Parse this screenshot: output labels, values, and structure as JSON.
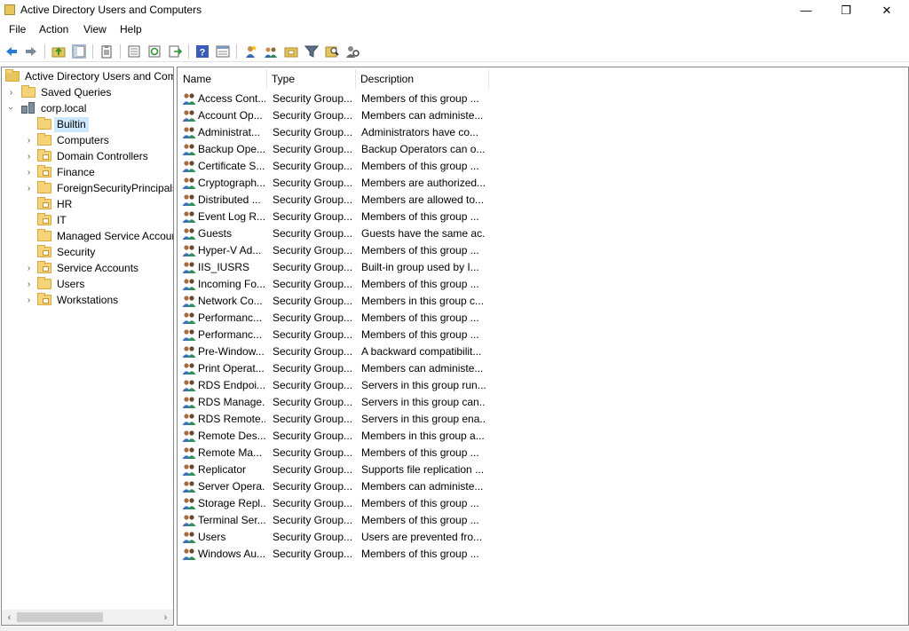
{
  "window": {
    "title": "Active Directory Users and Computers",
    "minimize_glyph": "—",
    "restore_glyph": "❐",
    "close_glyph": "✕"
  },
  "menu": [
    "File",
    "Action",
    "View",
    "Help"
  ],
  "toolbar_icons": [
    "back-icon",
    "forward-icon",
    "up-folder-icon",
    "show-console-tree-icon",
    "properties-icon",
    "export-list-icon",
    "refresh-icon",
    "export-icon",
    "help-icon",
    "details-icon",
    "new-user-icon",
    "new-group-icon",
    "new-ou-icon",
    "filter-icon",
    "find-icon",
    "delegate-icon"
  ],
  "tree": {
    "root": "Active Directory Users and Com",
    "saved_queries": "Saved Queries",
    "domain": "corp.local",
    "items": [
      {
        "label": "Builtin",
        "selected": true,
        "expandable": false,
        "ou": false
      },
      {
        "label": "Computers",
        "selected": false,
        "expandable": true,
        "ou": false
      },
      {
        "label": "Domain Controllers",
        "selected": false,
        "expandable": true,
        "ou": true
      },
      {
        "label": "Finance",
        "selected": false,
        "expandable": true,
        "ou": true
      },
      {
        "label": "ForeignSecurityPrincipals",
        "selected": false,
        "expandable": true,
        "ou": false
      },
      {
        "label": "HR",
        "selected": false,
        "expandable": false,
        "ou": true
      },
      {
        "label": "IT",
        "selected": false,
        "expandable": false,
        "ou": true
      },
      {
        "label": "Managed Service Accounts",
        "selected": false,
        "expandable": false,
        "ou": false
      },
      {
        "label": "Security",
        "selected": false,
        "expandable": false,
        "ou": true
      },
      {
        "label": "Service Accounts",
        "selected": false,
        "expandable": true,
        "ou": true
      },
      {
        "label": "Users",
        "selected": false,
        "expandable": true,
        "ou": false
      },
      {
        "label": "Workstations",
        "selected": false,
        "expandable": true,
        "ou": true
      }
    ]
  },
  "list": {
    "columns": [
      "Name",
      "Type",
      "Description"
    ],
    "rows": [
      {
        "name": "Access Cont...",
        "type": "Security Group...",
        "description": "Members of this group ..."
      },
      {
        "name": "Account Op...",
        "type": "Security Group...",
        "description": "Members can administe..."
      },
      {
        "name": "Administrat...",
        "type": "Security Group...",
        "description": "Administrators have co..."
      },
      {
        "name": "Backup Ope...",
        "type": "Security Group...",
        "description": "Backup Operators can o..."
      },
      {
        "name": "Certificate S...",
        "type": "Security Group...",
        "description": "Members of this group ..."
      },
      {
        "name": "Cryptograph...",
        "type": "Security Group...",
        "description": "Members are authorized..."
      },
      {
        "name": "Distributed ...",
        "type": "Security Group...",
        "description": "Members are allowed to..."
      },
      {
        "name": "Event Log R...",
        "type": "Security Group...",
        "description": "Members of this group ..."
      },
      {
        "name": "Guests",
        "type": "Security Group...",
        "description": "Guests have the same ac..."
      },
      {
        "name": "Hyper-V Ad...",
        "type": "Security Group...",
        "description": "Members of this group ..."
      },
      {
        "name": "IIS_IUSRS",
        "type": "Security Group...",
        "description": "Built-in group used by I..."
      },
      {
        "name": "Incoming Fo...",
        "type": "Security Group...",
        "description": "Members of this group ..."
      },
      {
        "name": "Network Co...",
        "type": "Security Group...",
        "description": "Members in this group c..."
      },
      {
        "name": "Performanc...",
        "type": "Security Group...",
        "description": "Members of this group ..."
      },
      {
        "name": "Performanc...",
        "type": "Security Group...",
        "description": "Members of this group ..."
      },
      {
        "name": "Pre-Window...",
        "type": "Security Group...",
        "description": "A backward compatibilit..."
      },
      {
        "name": "Print Operat...",
        "type": "Security Group...",
        "description": "Members can administe..."
      },
      {
        "name": "RDS Endpoi...",
        "type": "Security Group...",
        "description": "Servers in this group run..."
      },
      {
        "name": "RDS Manage...",
        "type": "Security Group...",
        "description": "Servers in this group can..."
      },
      {
        "name": "RDS Remote...",
        "type": "Security Group...",
        "description": "Servers in this group ena..."
      },
      {
        "name": "Remote Des...",
        "type": "Security Group...",
        "description": "Members in this group a..."
      },
      {
        "name": "Remote Ma...",
        "type": "Security Group...",
        "description": "Members of this group ..."
      },
      {
        "name": "Replicator",
        "type": "Security Group...",
        "description": "Supports file replication ..."
      },
      {
        "name": "Server Opera...",
        "type": "Security Group...",
        "description": "Members can administe..."
      },
      {
        "name": "Storage Repl...",
        "type": "Security Group...",
        "description": "Members of this group ..."
      },
      {
        "name": "Terminal Ser...",
        "type": "Security Group...",
        "description": "Members of this group ..."
      },
      {
        "name": "Users",
        "type": "Security Group...",
        "description": "Users are prevented fro..."
      },
      {
        "name": "Windows Au...",
        "type": "Security Group...",
        "description": "Members of this group ..."
      }
    ]
  },
  "colors": {
    "selection": "#cce8ff",
    "folder": "#f4d47a",
    "border": "#828790"
  }
}
